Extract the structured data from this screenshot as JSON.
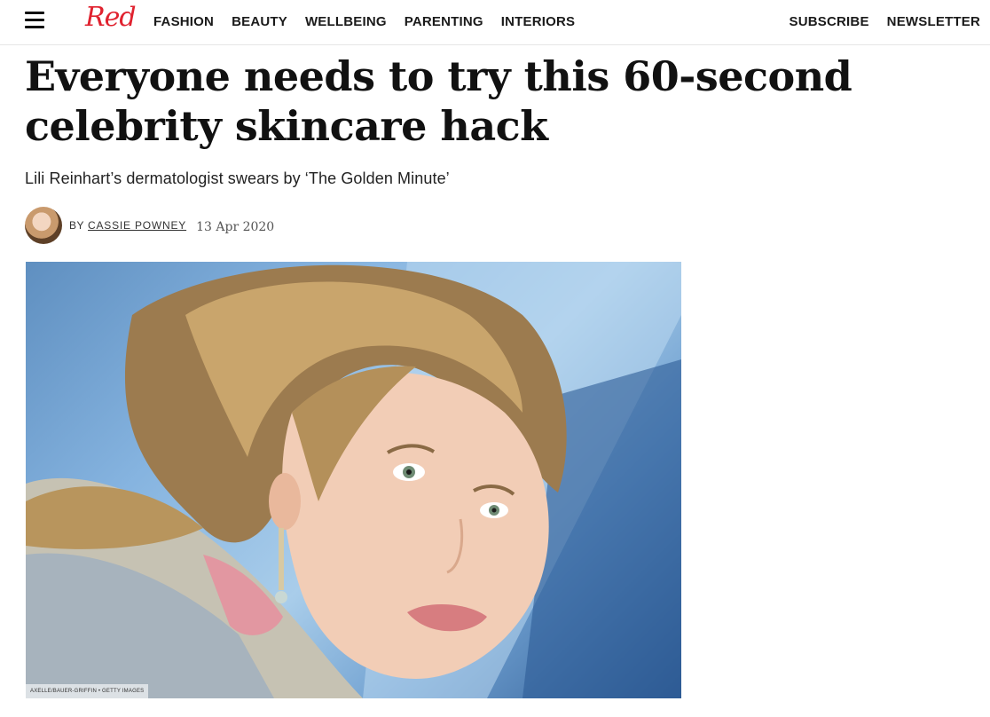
{
  "header": {
    "logo_text": "Red",
    "brand_color": "#e0222f",
    "nav": [
      "FASHION",
      "BEAUTY",
      "WELLBEING",
      "PARENTING",
      "INTERIORS"
    ],
    "subscribe_label": "SUBSCRIBE",
    "newsletter_label": "NEWSLETTER"
  },
  "article": {
    "headline": "Everyone needs to try this 60-second celebrity skincare hack",
    "dek": "Lili Reinhart’s dermatologist swears by ‘The Golden Minute’",
    "byline": {
      "by": "BY",
      "author": "CASSIE POWNEY",
      "date": "13 Apr 2020"
    },
    "hero_image": {
      "credit": "AXELLE/BAUER-GRIFFIN • GETTY IMAGES"
    }
  }
}
